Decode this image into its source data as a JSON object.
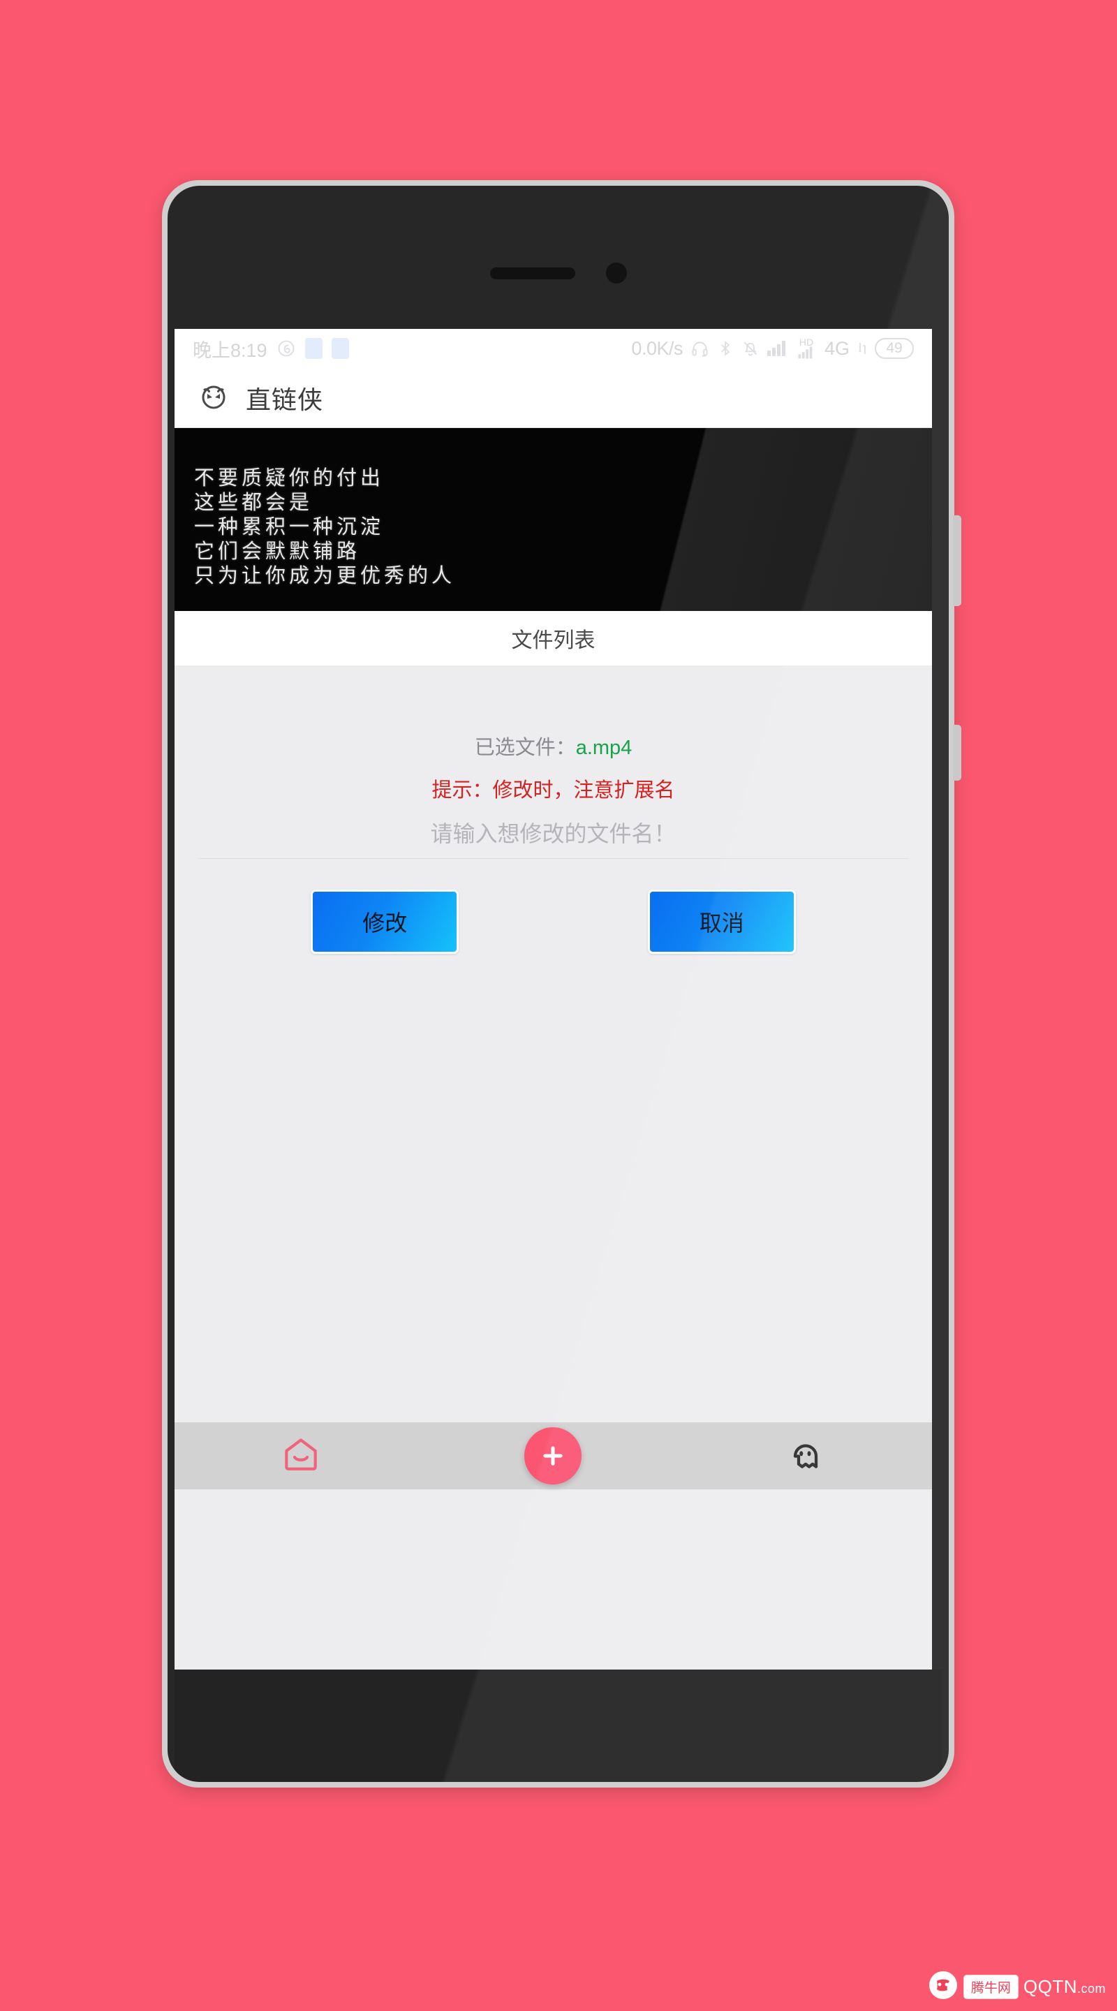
{
  "background_color": "#fb586f",
  "status_bar": {
    "time": "晚上8:19",
    "icons_left": [
      "music-note-icon",
      "notification-chip-icon",
      "notification-chip-icon"
    ],
    "net_speed": "0.0K/s",
    "icons_right": [
      "headphone-icon",
      "bluetooth-icon",
      "mute-bell-icon",
      "signal-bars-icon",
      "hd-signal-icon"
    ],
    "hd_label": "HD",
    "network_type": "4G",
    "battery_level": "49"
  },
  "app_bar": {
    "icon": "devil-face-icon",
    "title": "直链侠"
  },
  "banner": {
    "lines": [
      "不要质疑你的付出",
      "这些都会是",
      "一种累积一种沉淀",
      "它们会默默铺路",
      "只为让你成为更优秀的人"
    ]
  },
  "section_header": {
    "title": "文件列表"
  },
  "dialog": {
    "selected_label": "已选文件：",
    "selected_file": "a.mp4",
    "selected_file_color": "#17a34a",
    "hint": "提示：修改时，注意扩展名",
    "hint_color": "#d62121",
    "input_value": "",
    "input_placeholder": "请输入想修改的文件名！",
    "confirm_label": "修改",
    "cancel_label": "取消",
    "button_color": "#0e86f5"
  },
  "bottom_nav": {
    "items": [
      {
        "name": "home-smile-icon",
        "label": ""
      },
      {
        "name": "add-fab-icon",
        "label": ""
      },
      {
        "name": "ghost-icon",
        "label": ""
      }
    ],
    "fab_color": "#fb5572"
  },
  "watermark": {
    "label": "腾牛网",
    "domain": "QQTN",
    "domain_suffix": ".com"
  }
}
